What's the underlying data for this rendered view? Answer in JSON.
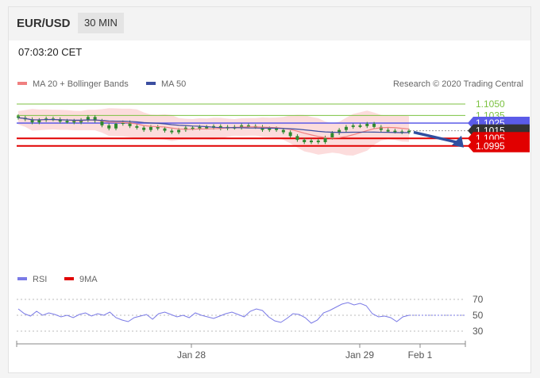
{
  "header": {
    "symbol": "EUR/USD",
    "interval": "30 MIN"
  },
  "timestamp": "07:03:20 CET",
  "legend": {
    "ma20": "MA 20 + Bollinger Bands",
    "ma50": "MA 50",
    "credit": "Research © 2020 Trading Central",
    "rsi": "RSI",
    "ma9": "9MA"
  },
  "colors": {
    "ma20": "#f08080",
    "ma50": "#3b4ea0",
    "bollinger": "#fbd0d0",
    "support": "#e10000",
    "resistance_green": "#7cc242",
    "resistance_blue": "#5b5be8",
    "current": "#333333",
    "candle": "#2f8a2f",
    "rsi": "#7a7ae6",
    "arrow": "#2f4fa0"
  },
  "chart_data": [
    {
      "type": "candlestick",
      "series": [
        {
          "name": "MA 20 + Bollinger Bands"
        },
        {
          "name": "MA 50"
        }
      ],
      "x_ticks": [
        "Jan 28",
        "Jan 29",
        "Feb 1"
      ],
      "levels": [
        {
          "value": 1.105,
          "label": "1.1050",
          "kind": "resistance"
        },
        {
          "value": 1.1035,
          "label": "1.1035",
          "kind": "resistance"
        },
        {
          "value": 1.1025,
          "label": "1.1025",
          "kind": "pivot"
        },
        {
          "value": 1.1015,
          "label": "1.1015",
          "kind": "current"
        },
        {
          "value": 1.1005,
          "label": "1.1005",
          "kind": "support"
        },
        {
          "value": 1.0995,
          "label": "1.0995",
          "kind": "support"
        }
      ],
      "close_approx": [
        1.1032,
        1.103,
        1.1026,
        1.1029,
        1.1031,
        1.103,
        1.1027,
        1.1028,
        1.1026,
        1.1029,
        1.1033,
        1.1028,
        1.1022,
        1.1018,
        1.1024,
        1.1026,
        1.1021,
        1.1019,
        1.1016,
        1.102,
        1.1018,
        1.1015,
        1.1013,
        1.1016,
        1.1019,
        1.1018,
        1.102,
        1.1019,
        1.1021,
        1.1018,
        1.102,
        1.1019,
        1.1022,
        1.1021,
        1.102,
        1.1016,
        1.1018,
        1.1016,
        1.1013,
        1.1008,
        1.1003,
        1.1,
        1.1002,
        1.1,
        1.1006,
        1.1012,
        1.1016,
        1.102,
        1.1022,
        1.1021,
        1.1024,
        1.102,
        1.1016,
        1.1015,
        1.1014,
        1.1013,
        1.1015
      ],
      "forecast_arrow": {
        "from": 1.1015,
        "to": 1.0995
      }
    },
    {
      "type": "line",
      "series": [
        {
          "name": "RSI"
        },
        {
          "name": "9MA"
        }
      ],
      "y_ticks": [
        70,
        50,
        30
      ],
      "ylim": [
        25,
        75
      ],
      "rsi_approx": [
        58,
        52,
        49,
        55,
        50,
        53,
        51,
        48,
        50,
        47,
        51,
        53,
        49,
        52,
        50,
        54,
        47,
        44,
        42,
        47,
        49,
        51,
        45,
        52,
        54,
        51,
        48,
        50,
        47,
        53,
        50,
        48,
        46,
        49,
        52,
        54,
        51,
        48,
        55,
        58,
        56,
        48,
        43,
        41,
        46,
        52,
        51,
        47,
        40,
        44,
        53,
        56,
        60,
        64,
        66,
        63,
        65,
        62,
        52,
        48,
        49,
        47,
        42,
        48,
        50
      ],
      "ma9_level": 50
    }
  ]
}
